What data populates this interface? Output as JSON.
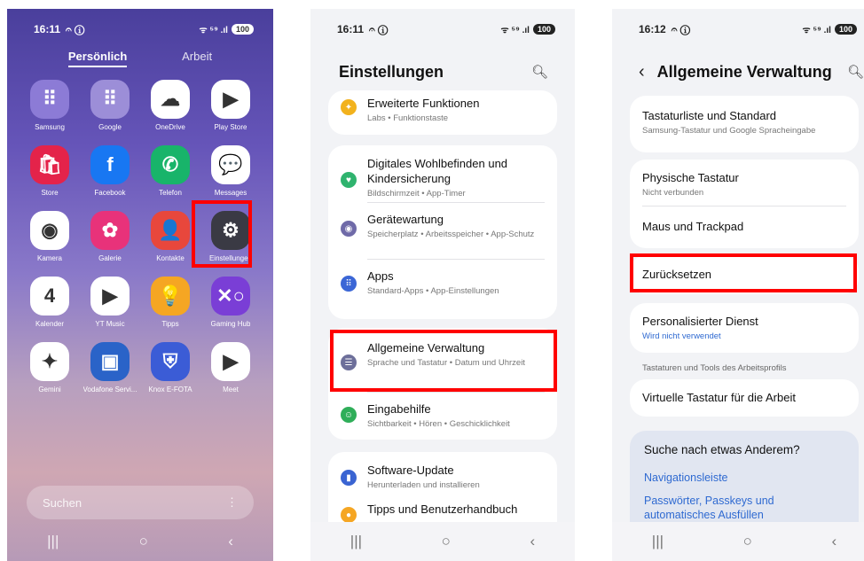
{
  "phone1": {
    "time": "16:11",
    "status_icons": "𝄐 ⓘ",
    "signal": "ᯤ ⁵⁹ .ıl",
    "battery": "100",
    "tabs": {
      "personal": "Persönlich",
      "work": "Arbeit"
    },
    "apps": [
      {
        "label": "Samsung",
        "glyph": "⠿",
        "color": "#8c7bd6",
        "icon_name": "samsung-folder-icon"
      },
      {
        "label": "Google",
        "glyph": "⠿",
        "color": "#9c8ed8",
        "icon_name": "google-folder-icon"
      },
      {
        "label": "OneDrive",
        "glyph": "☁",
        "color": "#ffffff",
        "icon_name": "onedrive-icon"
      },
      {
        "label": "Play Store",
        "glyph": "▶",
        "color": "#ffffff",
        "icon_name": "play-store-icon"
      },
      {
        "label": "Store",
        "glyph": "🛍",
        "color": "#e4234a",
        "icon_name": "galaxy-store-icon"
      },
      {
        "label": "Facebook",
        "glyph": "f",
        "color": "#1877f2",
        "icon_name": "facebook-icon"
      },
      {
        "label": "Telefon",
        "glyph": "✆",
        "color": "#18b46a",
        "icon_name": "phone-icon"
      },
      {
        "label": "Messages",
        "glyph": "💬",
        "color": "#ffffff",
        "icon_name": "messages-icon"
      },
      {
        "label": "Kamera",
        "glyph": "◉",
        "color": "#ffffff",
        "icon_name": "camera-icon"
      },
      {
        "label": "Galerie",
        "glyph": "✿",
        "color": "#e8327a",
        "icon_name": "gallery-icon"
      },
      {
        "label": "Kontakte",
        "glyph": "👤",
        "color": "#e8473c",
        "icon_name": "contacts-icon"
      },
      {
        "label": "Einstellungen",
        "glyph": "⚙",
        "color": "#3a3a44",
        "icon_name": "settings-gear-icon"
      },
      {
        "label": "Kalender",
        "glyph": "4",
        "color": "#ffffff",
        "icon_name": "calendar-icon"
      },
      {
        "label": "YT Music",
        "glyph": "▶",
        "color": "#ffffff",
        "icon_name": "yt-music-icon"
      },
      {
        "label": "Tipps",
        "glyph": "💡",
        "color": "#f5a623",
        "icon_name": "tips-icon"
      },
      {
        "label": "Gaming Hub",
        "glyph": "✕○",
        "color": "#7a3ed6",
        "icon_name": "gaming-hub-icon"
      },
      {
        "label": "Gemini",
        "glyph": "✦",
        "color": "#ffffff",
        "icon_name": "gemini-icon"
      },
      {
        "label": "Vodafone Servi...",
        "glyph": "▣",
        "color": "#2a63c8",
        "icon_name": "vodafone-icon"
      },
      {
        "label": "Knox E-FOTA",
        "glyph": "⛨",
        "color": "#3b5cd6",
        "icon_name": "knox-icon"
      },
      {
        "label": "Meet",
        "glyph": "▶",
        "color": "#ffffff",
        "icon_name": "meet-icon"
      }
    ],
    "search_placeholder": "Suchen",
    "search_menu": "⋮"
  },
  "phone2": {
    "time": "16:11",
    "title": "Einstellungen",
    "items": [
      {
        "title": "Erweiterte Funktionen",
        "sub": "Labs • Funktionstaste",
        "color": "#f2b21d",
        "icon": "advanced-features-icon"
      },
      {
        "title": "Digitales Wohlbefinden und Kindersicherung",
        "sub": "Bildschirmzeit • App-Timer",
        "color": "#2fb36e",
        "icon": "digital-wellbeing-icon"
      },
      {
        "title": "Gerätewartung",
        "sub": "Speicherplatz • Arbeitsspeicher • App-Schutz",
        "color": "#6f6aa8",
        "icon": "device-care-icon"
      },
      {
        "title": "Apps",
        "sub": "Standard-Apps • App-Einstellungen",
        "color": "#3b66d6",
        "icon": "apps-icon"
      },
      {
        "title": "Allgemeine Verwaltung",
        "sub": "Sprache und Tastatur • Datum und Uhrzeit",
        "color": "#6d6f9a",
        "icon": "general-management-icon"
      },
      {
        "title": "Eingabehilfe",
        "sub": "Sichtbarkeit • Hören • Geschicklichkeit",
        "color": "#2fae59",
        "icon": "accessibility-icon"
      },
      {
        "title": "Software-Update",
        "sub": "Herunterladen und installieren",
        "color": "#3a64d2",
        "icon": "software-update-icon"
      },
      {
        "title": "Tipps und Benutzerhandbuch",
        "sub": "",
        "color": "#f5a623",
        "icon": "tips-manual-icon"
      }
    ]
  },
  "phone3": {
    "time": "16:12",
    "title": "Allgemeine Verwaltung",
    "items": {
      "keyboard_list": {
        "title": "Tastaturliste und Standard",
        "sub": "Samsung-Tastatur und Google Spracheingabe"
      },
      "physical_keyboard": {
        "title": "Physische Tastatur",
        "sub": "Nicht verbunden"
      },
      "mouse_trackpad": {
        "title": "Maus und Trackpad"
      },
      "reset": {
        "title": "Zurücksetzen"
      },
      "personalized": {
        "title": "Personalisierter Dienst",
        "sub": "Wird nicht verwendet"
      },
      "work_keyboard": {
        "title": "Virtuelle Tastatur für die Arbeit"
      }
    },
    "section_label": "Tastaturen und Tools des Arbeitsprofils",
    "suggest": {
      "title": "Suche nach etwas Anderem?",
      "links": [
        "Navigationsleiste",
        "Passwörter, Passkeys und automatisches Ausfüllen"
      ]
    }
  },
  "navbar": {
    "recents": "|||",
    "home": "○",
    "back": "‹"
  }
}
